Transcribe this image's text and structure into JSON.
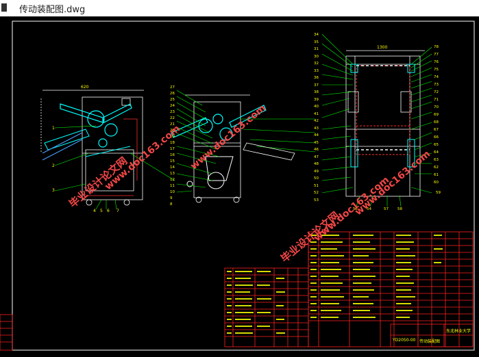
{
  "window": {
    "title": "传动装配图.dwg"
  },
  "drawing": {
    "background": "#000000",
    "line_color": "#ffffff",
    "table_color": "#ff2020",
    "text_color": "#ffff00",
    "leader_color": "#00ff00",
    "part_color": "#00ffff"
  },
  "watermarks": {
    "cn": "毕业设计论文网",
    "url": "www.doc163.com"
  },
  "view_a": {
    "dimension": "620",
    "balloons": [
      "1",
      "2",
      "3",
      "4",
      "5",
      "6",
      "7"
    ]
  },
  "view_b": {
    "balloons": [
      "27",
      "26",
      "25",
      "24",
      "23",
      "22",
      "21",
      "20",
      "19",
      "18",
      "17",
      "16",
      "15",
      "14",
      "13",
      "12",
      "11",
      "10",
      "9",
      "8"
    ]
  },
  "view_c": {
    "dimension": "1300",
    "left_balloons": [
      "34",
      "35",
      "31",
      "30",
      "32",
      "33",
      "36",
      "37",
      "38",
      "39",
      "40",
      "41",
      "42",
      "43",
      "44",
      "45",
      "46",
      "47",
      "48",
      "49",
      "50",
      "51",
      "52",
      "53"
    ],
    "right_balloons": [
      "78",
      "77",
      "76",
      "75",
      "74",
      "73",
      "72",
      "71",
      "70",
      "69",
      "68",
      "67",
      "66",
      "65",
      "64",
      "63",
      "62",
      "61",
      "60"
    ],
    "bottom_balloons": [
      "55",
      "54",
      "57",
      "58",
      "59"
    ]
  },
  "title_block": {
    "drawing_no": "YD2050-00",
    "name": "传动装配图",
    "school": "东北林业大学"
  }
}
